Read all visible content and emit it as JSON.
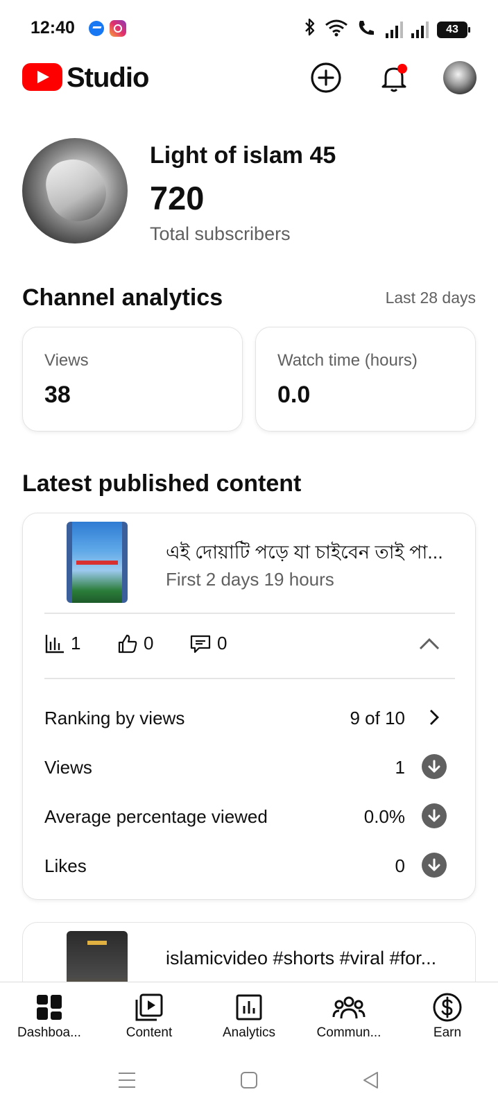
{
  "status_bar": {
    "time": "12:40",
    "battery": "43",
    "icons": [
      "messenger-icon",
      "instagram-icon",
      "bluetooth-icon",
      "wifi-icon",
      "volte-call-icon",
      "signal-icon",
      "signal-icon",
      "battery-icon"
    ]
  },
  "header": {
    "app_name": "Studio",
    "icons": [
      "youtube-logo-icon",
      "create-icon",
      "notifications-icon",
      "account-avatar"
    ],
    "accent_color": "#ff0000",
    "notification_dot_color": "#ff0000"
  },
  "channel": {
    "name": "Light of islam 45",
    "subscribers": "720",
    "subscribers_label": "Total subscribers"
  },
  "analytics": {
    "title": "Channel analytics",
    "period": "Last 28 days",
    "cards": [
      {
        "label": "Views",
        "value": "38"
      },
      {
        "label": "Watch time (hours)",
        "value": "0.0"
      }
    ]
  },
  "latest": {
    "title": "Latest published content",
    "video": {
      "title": "এই দোয়াটি পড়ে যা চাইবেন তাই পা...",
      "meta": "First 2 days 19 hours",
      "views": "1",
      "likes": "0",
      "comments": "0"
    },
    "details": [
      {
        "label": "Ranking by views",
        "value": "9 of 10",
        "action_icon": "chevron-right-icon"
      },
      {
        "label": "Views",
        "value": "1",
        "action_icon": "arrow-down-circle-icon"
      },
      {
        "label": "Average percentage viewed",
        "value": "0.0%",
        "action_icon": "arrow-down-circle-icon"
      },
      {
        "label": "Likes",
        "value": "0",
        "action_icon": "arrow-down-circle-icon"
      }
    ],
    "video2": {
      "title": "islamicvideo #shorts #viral #for..."
    }
  },
  "bottom_nav": [
    {
      "label": "Dashboa...",
      "icon": "dashboard-icon"
    },
    {
      "label": "Content",
      "icon": "content-icon"
    },
    {
      "label": "Analytics",
      "icon": "analytics-icon"
    },
    {
      "label": "Commun...",
      "icon": "community-icon"
    },
    {
      "label": "Earn",
      "icon": "earn-icon"
    }
  ],
  "system_nav": {
    "icons": [
      "recent-apps-icon",
      "home-icon",
      "back-icon"
    ]
  }
}
